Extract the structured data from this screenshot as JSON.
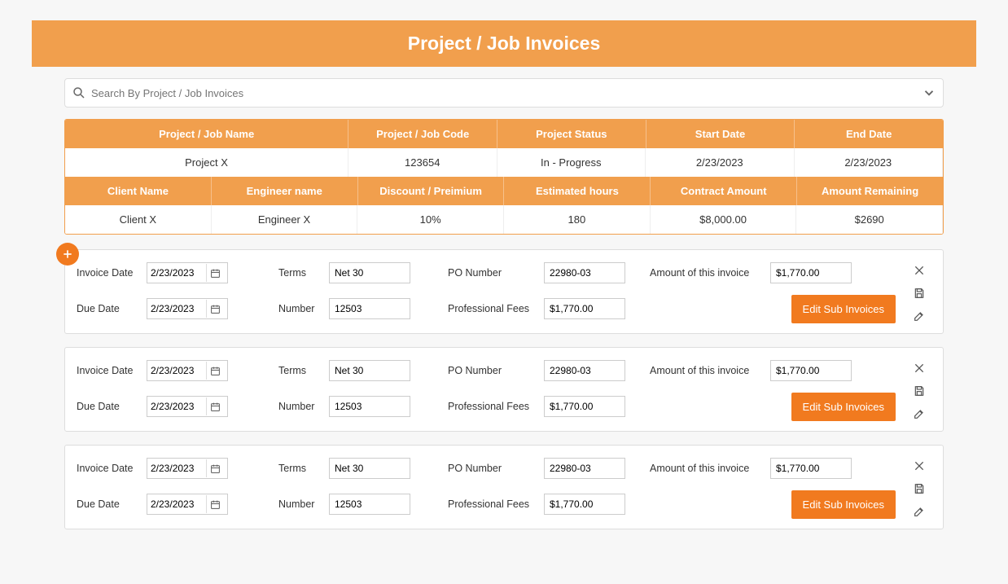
{
  "page_title": "Project / Job Invoices",
  "search": {
    "placeholder": "Search By Project / Job Invoices"
  },
  "project_table": {
    "row1_headers": [
      "Project / Job Name",
      "Project / Job Code",
      "Project Status",
      "Start Date",
      "End Date"
    ],
    "row1_values": [
      "Project X",
      "123654",
      "In - Progress",
      "2/23/2023",
      "2/23/2023"
    ],
    "row2_headers": [
      "Client Name",
      "Engineer name",
      "Discount / Preimium",
      "Estimated hours",
      "Contract Amount",
      "Amount Remaining"
    ],
    "row2_values": [
      "Client X",
      "Engineer X",
      "10%",
      "180",
      "$8,000.00",
      "$2690"
    ]
  },
  "labels": {
    "invoice_date": "Invoice Date",
    "due_date": "Due Date",
    "terms": "Terms",
    "number": "Number",
    "po_number": "PO Number",
    "professional_fees": "Professional Fees",
    "amount_invoice": "Amount of this invoice",
    "edit_sub": "Edit Sub Invoices"
  },
  "invoices": [
    {
      "invoice_date": "2/23/2023",
      "due_date": "2/23/2023",
      "terms": "Net 30",
      "number": "12503",
      "po_number": "22980-03",
      "professional_fees": "$1,770.00",
      "amount": "$1,770.00"
    },
    {
      "invoice_date": "2/23/2023",
      "due_date": "2/23/2023",
      "terms": "Net 30",
      "number": "12503",
      "po_number": "22980-03",
      "professional_fees": "$1,770.00",
      "amount": "$1,770.00"
    },
    {
      "invoice_date": "2/23/2023",
      "due_date": "2/23/2023",
      "terms": "Net 30",
      "number": "12503",
      "po_number": "22980-03",
      "professional_fees": "$1,770.00",
      "amount": "$1,770.00"
    }
  ]
}
